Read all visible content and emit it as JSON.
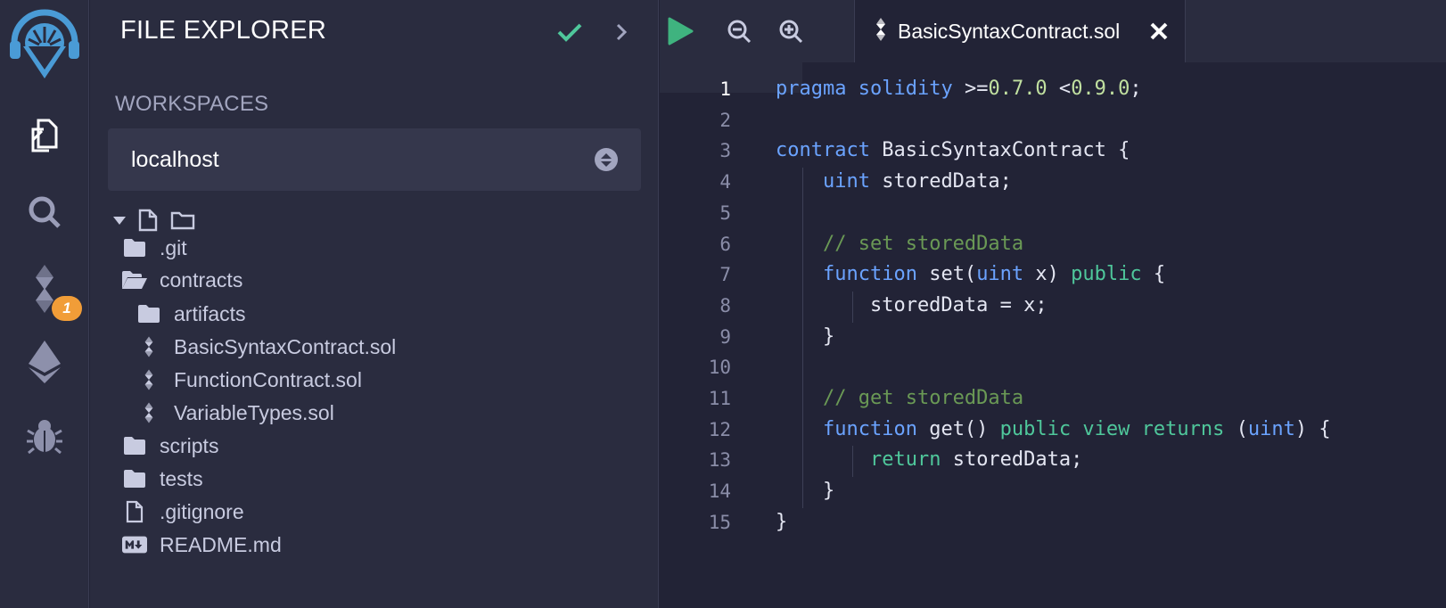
{
  "rail": {
    "items": [
      {
        "name": "logo-icon"
      },
      {
        "name": "file-explorer-icon"
      },
      {
        "name": "search-icon"
      },
      {
        "name": "solidity-compiler-icon",
        "badge": "1"
      },
      {
        "name": "deploy-run-icon"
      },
      {
        "name": "debugger-icon"
      }
    ]
  },
  "panel": {
    "title": "FILE EXPLORER",
    "workspaces_label": "WORKSPACES",
    "workspace_selected": "localhost",
    "tree": [
      {
        "label": ".git",
        "type": "folder",
        "depth": 0
      },
      {
        "label": "contracts",
        "type": "folder-open",
        "depth": 0
      },
      {
        "label": "artifacts",
        "type": "folder",
        "depth": 1
      },
      {
        "label": "BasicSyntaxContract.sol",
        "type": "solidity",
        "depth": 1
      },
      {
        "label": "FunctionContract.sol",
        "type": "solidity",
        "depth": 1
      },
      {
        "label": "VariableTypes.sol",
        "type": "solidity",
        "depth": 1
      },
      {
        "label": "scripts",
        "type": "folder",
        "depth": 0
      },
      {
        "label": "tests",
        "type": "folder",
        "depth": 0
      },
      {
        "label": ".gitignore",
        "type": "file",
        "depth": 0
      },
      {
        "label": "README.md",
        "type": "markdown",
        "depth": 0
      }
    ]
  },
  "editor": {
    "tab_label": "BasicSyntaxContract.sol",
    "active_line": 1,
    "lines": [
      [
        {
          "t": "pragma",
          "c": "k1"
        },
        {
          "t": " "
        },
        {
          "t": "solidity",
          "c": "k1"
        },
        {
          "t": " >="
        },
        {
          "t": "0.7.0",
          "c": "num"
        },
        {
          "t": " <"
        },
        {
          "t": "0.9.0",
          "c": "num"
        },
        {
          "t": ";"
        }
      ],
      [],
      [
        {
          "t": "contract",
          "c": "k1"
        },
        {
          "t": " BasicSyntaxContract {"
        }
      ],
      [
        {
          "t": "    "
        },
        {
          "t": "uint",
          "c": "k1"
        },
        {
          "t": " storedData;"
        }
      ],
      [],
      [
        {
          "t": "    "
        },
        {
          "t": "// set storedData",
          "c": "cmt"
        }
      ],
      [
        {
          "t": "    "
        },
        {
          "t": "function",
          "c": "k1"
        },
        {
          "t": " set("
        },
        {
          "t": "uint",
          "c": "k1"
        },
        {
          "t": " x) "
        },
        {
          "t": "public",
          "c": "k2"
        },
        {
          "t": " {"
        }
      ],
      [
        {
          "t": "        storedData = x;"
        }
      ],
      [
        {
          "t": "    }"
        }
      ],
      [],
      [
        {
          "t": "    "
        },
        {
          "t": "// get storedData",
          "c": "cmt"
        }
      ],
      [
        {
          "t": "    "
        },
        {
          "t": "function",
          "c": "k1"
        },
        {
          "t": " get() "
        },
        {
          "t": "public",
          "c": "k2"
        },
        {
          "t": " "
        },
        {
          "t": "view",
          "c": "k2"
        },
        {
          "t": " "
        },
        {
          "t": "returns",
          "c": "k2"
        },
        {
          "t": " ("
        },
        {
          "t": "uint",
          "c": "k1"
        },
        {
          "t": ") {"
        }
      ],
      [
        {
          "t": "        "
        },
        {
          "t": "return",
          "c": "k2"
        },
        {
          "t": " storedData;"
        }
      ],
      [
        {
          "t": "    }"
        }
      ],
      [
        {
          "t": "}"
        }
      ]
    ]
  },
  "colors": {
    "accent_green": "#4fc79b",
    "badge": "#f19d38",
    "run_button": "#3fb37f"
  }
}
